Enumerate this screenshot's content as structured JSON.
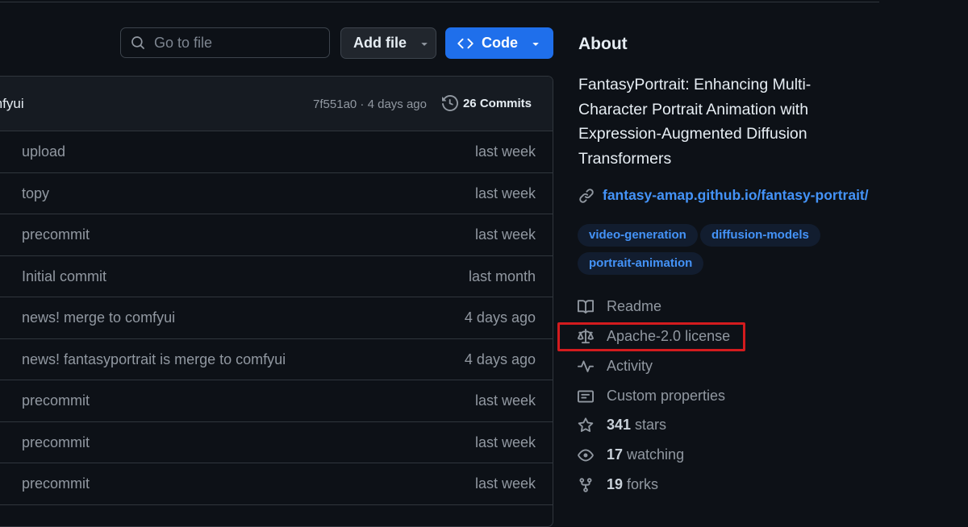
{
  "toolbar": {
    "search_placeholder": "Go to file",
    "add_file_label": "Add file",
    "code_label": "Code"
  },
  "latest_commit": {
    "author": "mfyui",
    "meta": "7f551a0 · 4 days ago",
    "commits_count": "26 Commits"
  },
  "files": [
    {
      "message": "upload",
      "time": "last week"
    },
    {
      "message": "topy",
      "time": "last week"
    },
    {
      "message": "precommit",
      "time": "last week"
    },
    {
      "message": "Initial commit",
      "time": "last month"
    },
    {
      "message": "news! merge to comfyui",
      "time": "4 days ago"
    },
    {
      "message": "news! fantasyportrait is merge to comfyui",
      "time": "4 days ago"
    },
    {
      "message": "precommit",
      "time": "last week"
    },
    {
      "message": "precommit",
      "time": "last week"
    },
    {
      "message": "precommit",
      "time": "last week"
    }
  ],
  "about": {
    "title": "About",
    "description": "FantasyPortrait: Enhancing Multi-Character Portrait Animation with Expression-Augmented Diffusion Transformers",
    "homepage": "fantasy-amap.github.io/fantasy-portrait/",
    "topics": [
      "video-generation",
      "diffusion-models",
      "portrait-animation"
    ],
    "readme": "Readme",
    "license": "Apache-2.0 license",
    "activity": "Activity",
    "custom_properties": "Custom properties",
    "stars_count": "341",
    "stars_label": "stars",
    "watching_count": "17",
    "watching_label": "watching",
    "forks_count": "19",
    "forks_label": "forks"
  },
  "colors": {
    "background": "#0d1117",
    "accent_blue": "#1f6feb",
    "link_blue": "#4493f8",
    "highlight_red": "#d31b1e"
  },
  "icons": [
    "search-icon",
    "caret-down-icon",
    "code-icon",
    "history-icon",
    "link-icon",
    "book-icon",
    "law-icon",
    "pulse-icon",
    "note-icon",
    "star-icon",
    "eye-icon",
    "fork-icon"
  ]
}
